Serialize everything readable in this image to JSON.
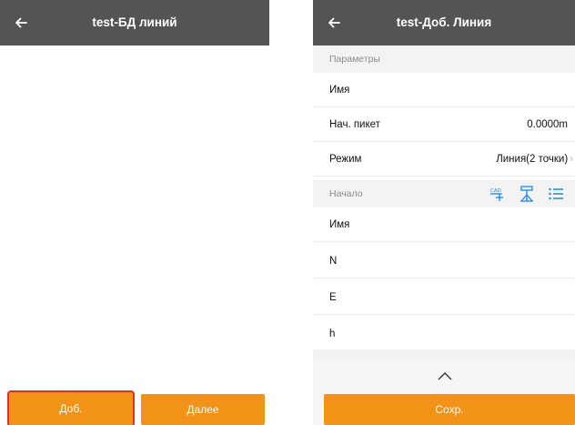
{
  "left": {
    "title": "test-БД линий",
    "back_icon": "arrow-left-icon",
    "buttons": {
      "add_label": "Доб.",
      "next_label": "Далее"
    }
  },
  "right": {
    "title": "test-Доб. Линия",
    "back_icon": "arrow-left-icon",
    "sections": {
      "params_label": "Параметры",
      "start_label": "Начало"
    },
    "params": {
      "name_label": "Имя",
      "start_station_label": "Нач. пикет",
      "start_station_value": "0.0000m",
      "mode_label": "Режим",
      "mode_value": "Линия(2 точки)",
      "mode_chevron": "›"
    },
    "start_icons": [
      "cad-point-icon",
      "survey-pole-icon",
      "list-icon"
    ],
    "start": {
      "name_label": "Имя",
      "n_label": "N",
      "e_label": "E",
      "h_label": "h"
    },
    "collapse_icon": "chevron-up-icon",
    "save_label": "Сохр."
  },
  "colors": {
    "appbar": "#545454",
    "accent": "#f29318",
    "icon_blue": "#1e88e5",
    "highlight_outline": "#e0302a",
    "section_bg": "#f3f3f3"
  }
}
